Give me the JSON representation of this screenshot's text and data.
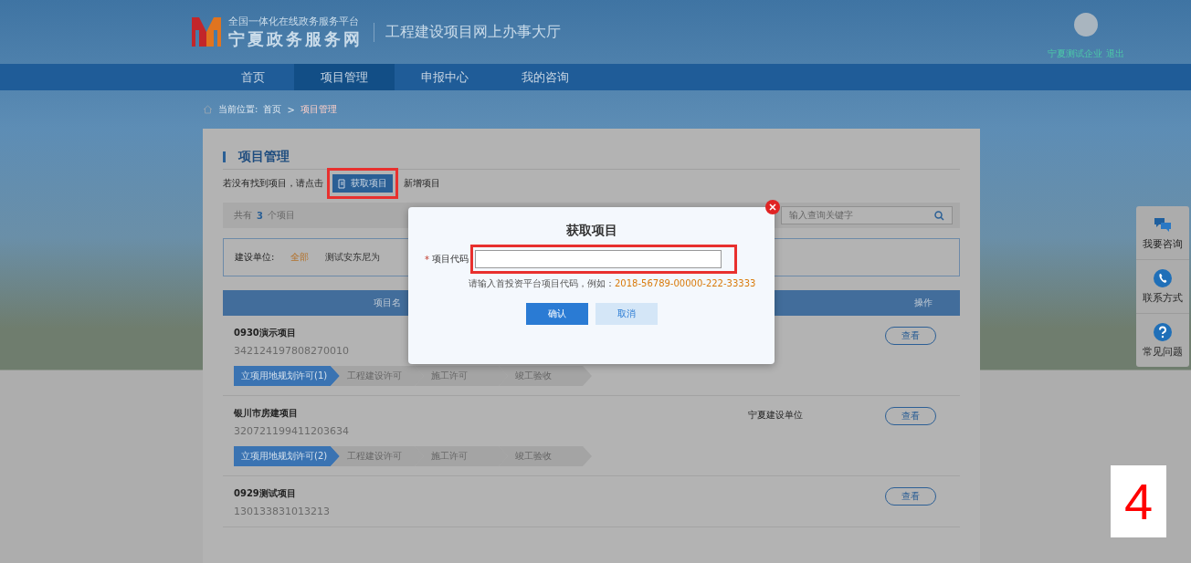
{
  "header": {
    "logo_line1": "全国一体化在线政务服务平台",
    "logo_line2": "宁夏政务服务网",
    "portal_title": "工程建设项目网上办事大厅",
    "user": "宁夏测试企业",
    "logout": "退出"
  },
  "nav": [
    {
      "label": "首页",
      "selected": false
    },
    {
      "label": "项目管理",
      "selected": true
    },
    {
      "label": "申报中心",
      "selected": false
    },
    {
      "label": "我的咨询",
      "selected": false
    }
  ],
  "breadcrumb": {
    "label": "当前位置:",
    "items": [
      "首页",
      "项目管理"
    ],
    "separator": ">"
  },
  "section_title": "项目管理",
  "notice": {
    "before": "若没有找到项目，请点击",
    "button": "获取项目",
    "after": "新增项目"
  },
  "summary": {
    "prefix": "共有",
    "count": "3",
    "suffix": "个项目"
  },
  "search": {
    "placeholder": "输入查询关键字"
  },
  "filter": {
    "label": "建设单位:",
    "options": [
      {
        "label": "全部",
        "selected": true
      },
      {
        "label": "测试安东尼为",
        "selected": false
      }
    ]
  },
  "table": {
    "columns": [
      "项目名",
      "操作"
    ],
    "rows": [
      {
        "name": "0930演示项目",
        "code": "342124197808270010",
        "unit": "",
        "action": "查看",
        "steps": [
          {
            "label": "立项用地规划许可(1)",
            "selected": true
          },
          {
            "label": "工程建设许可",
            "selected": false
          },
          {
            "label": "施工许可",
            "selected": false
          },
          {
            "label": "竣工验收",
            "selected": false
          }
        ]
      },
      {
        "name": "银川市房建项目",
        "code": "320721199411203634",
        "unit": "宁夏建设单位",
        "action": "查看",
        "steps": [
          {
            "label": "立项用地规划许可(2)",
            "selected": true
          },
          {
            "label": "工程建设许可",
            "selected": false
          },
          {
            "label": "施工许可",
            "selected": false
          },
          {
            "label": "竣工验收",
            "selected": false
          }
        ]
      },
      {
        "name": "0929测试项目",
        "code": "130133831013213",
        "unit": "",
        "action": "查看",
        "steps": []
      }
    ]
  },
  "modal": {
    "title": "获取项目",
    "required_mark": "*",
    "field_label": "项目代码",
    "hint": "请输入首投资平台项目代码，例如：",
    "example": "2018-56789-00000-222-33333",
    "confirm": "确认",
    "cancel": "取消"
  },
  "side_tools": [
    {
      "kind": "chat",
      "label": "我要咨询"
    },
    {
      "kind": "phone",
      "label": "联系方式"
    },
    {
      "kind": "help",
      "label": "常见问题"
    }
  ],
  "step_number": "4"
}
